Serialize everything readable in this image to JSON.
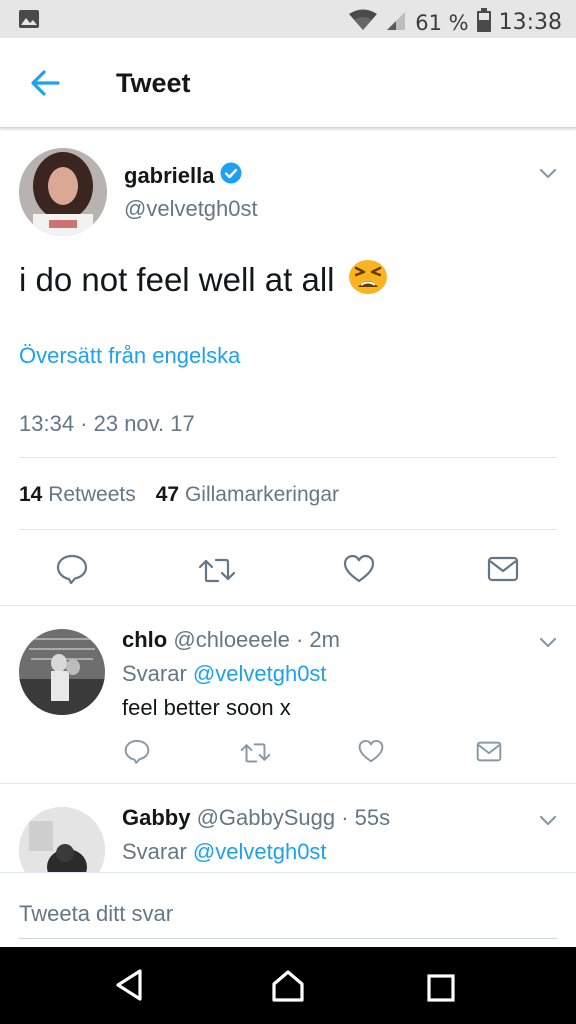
{
  "status_bar": {
    "battery": "61 %",
    "time": "13:38",
    "icons": [
      "gallery-icon",
      "wifi-icon",
      "signal-icon",
      "battery-icon"
    ]
  },
  "header": {
    "title": "Tweet"
  },
  "tweet": {
    "name": "gabriella",
    "handle": "@velvetgh0st",
    "text": "i do not feel well at all",
    "emoji": "😫",
    "translate_label": "Översätt från engelska",
    "timestamp": "13:34 · 23 nov. 17",
    "retweets_count": "14",
    "retweets_label": "Retweets",
    "likes_count": "47",
    "likes_label": "Gillamarkeringar"
  },
  "replies": [
    {
      "name": "chlo",
      "handle_time": "@chloeeele · 2m",
      "replying_prefix": "Svarar",
      "replying_to": "@velvetgh0st",
      "text": "feel better soon x"
    },
    {
      "name": "Gabby",
      "handle_time": "@GabbySugg · 55s",
      "replying_prefix": "Svarar",
      "replying_to": "@velvetgh0st",
      "text": ""
    }
  ],
  "reply_bar": {
    "placeholder": "Tweeta ditt svar"
  },
  "colors": {
    "accent": "#1da1f2",
    "secondary_text": "#657786",
    "primary_text": "#14171a",
    "divider": "#e1e8ed"
  }
}
